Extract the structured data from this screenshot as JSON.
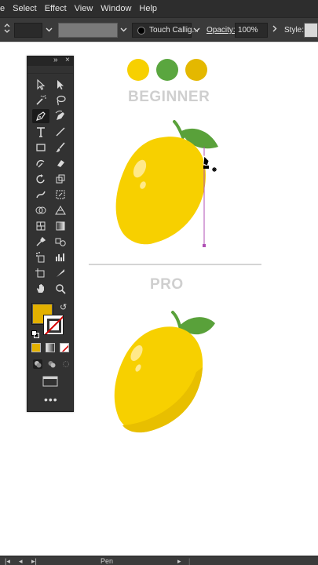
{
  "menu": [
    "e",
    "Select",
    "Effect",
    "View",
    "Window",
    "Help"
  ],
  "controlbar": {
    "brush_name": "Touch Callig...",
    "opacity_label": "Opacity:",
    "opacity_value": "100%",
    "style_label": "Style:"
  },
  "artboard": {
    "beginner_heading": "BEGINNER",
    "pro_heading": "PRO",
    "swatches": [
      "#f7d000",
      "#5aa63f",
      "#e4b800"
    ]
  },
  "colors": {
    "lemon_yellow": "#f7d000",
    "lemon_shadow": "#e8bf00",
    "leaf_green": "#59a13a",
    "fill_swatch": "#e3b100",
    "path_magenta": "#b04fb5"
  },
  "tools": [
    "selection-tool-icon",
    "direct-selection-tool-icon",
    "magic-wand-tool-icon",
    "lasso-tool-icon",
    "pen-tool-icon",
    "curvature-tool-icon",
    "type-tool-icon",
    "line-segment-tool-icon",
    "rectangle-tool-icon",
    "paintbrush-tool-icon",
    "shaper-tool-icon",
    "eraser-tool-icon",
    "rotate-tool-icon",
    "scale-tool-icon",
    "warp-tool-icon",
    "free-transform-tool-icon",
    "shape-builder-tool-icon",
    "perspective-grid-tool-icon",
    "mesh-tool-icon",
    "gradient-tool-icon",
    "eyedropper-tool-icon",
    "blend-tool-icon",
    "symbol-sprayer-tool-icon",
    "column-graph-tool-icon",
    "artboard-tool-icon",
    "slice-tool-icon",
    "hand-tool-icon",
    "zoom-tool-icon"
  ],
  "statusbar": {
    "tool_name": "Pen"
  }
}
